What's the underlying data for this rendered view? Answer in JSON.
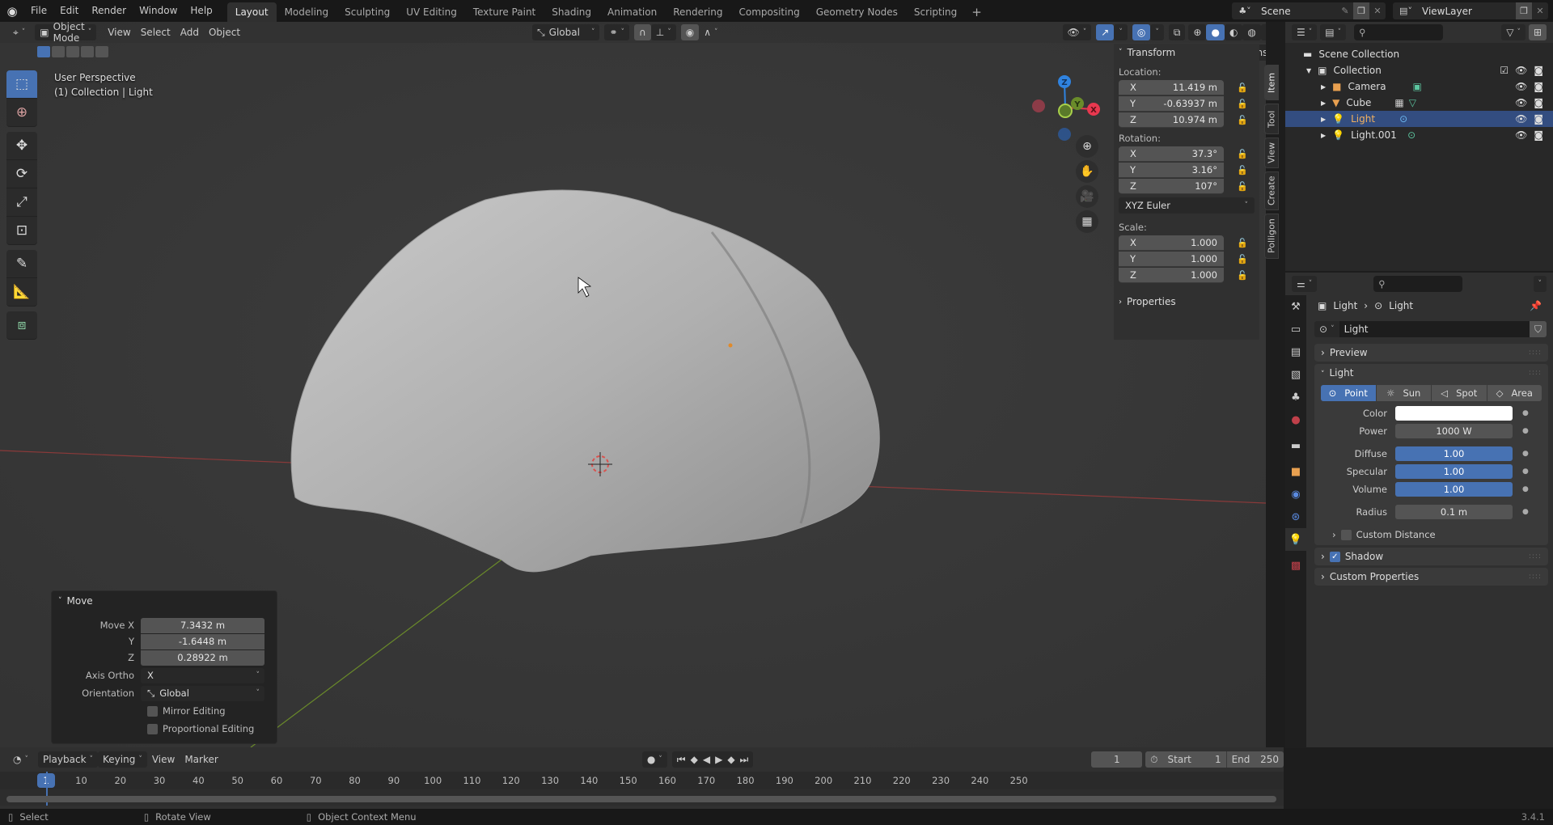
{
  "app": {
    "version": "3.4.1"
  },
  "topbar": {
    "menus": [
      "File",
      "Edit",
      "Render",
      "Window",
      "Help"
    ],
    "workspaces": [
      "Layout",
      "Modeling",
      "Sculpting",
      "UV Editing",
      "Texture Paint",
      "Shading",
      "Animation",
      "Rendering",
      "Compositing",
      "Geometry Nodes",
      "Scripting"
    ],
    "active_workspace": "Layout",
    "add_workspace": "+",
    "scene": "Scene",
    "view_layer": "ViewLayer"
  },
  "viewport": {
    "mode": "Object Mode",
    "menus": [
      "View",
      "Select",
      "Add",
      "Object"
    ],
    "orientation": "Global",
    "options_label": "Options",
    "info_line1": "User Perspective",
    "info_line2": "(1) Collection | Light",
    "gizmo_axes": {
      "x": "X",
      "y": "Y",
      "z": "Z"
    },
    "axis_colors": {
      "x": "#e8384f",
      "y": "#8cc63e",
      "z": "#2f83e0"
    }
  },
  "npanel": {
    "tabs": [
      "Item",
      "Tool",
      "View",
      "Create",
      "Polligon"
    ],
    "active_tab": "Item",
    "transform_title": "Transform",
    "location_label": "Location:",
    "location": [
      {
        "axis": "X",
        "value": "11.419 m"
      },
      {
        "axis": "Y",
        "value": "-0.63937 m"
      },
      {
        "axis": "Z",
        "value": "10.974 m"
      }
    ],
    "rotation_label": "Rotation:",
    "rotation": [
      {
        "axis": "X",
        "value": "37.3°"
      },
      {
        "axis": "Y",
        "value": "3.16°"
      },
      {
        "axis": "Z",
        "value": "107°"
      }
    ],
    "rotation_mode": "XYZ Euler",
    "scale_label": "Scale:",
    "scale": [
      {
        "axis": "X",
        "value": "1.000"
      },
      {
        "axis": "Y",
        "value": "1.000"
      },
      {
        "axis": "Z",
        "value": "1.000"
      }
    ],
    "properties_title": "Properties"
  },
  "move_panel": {
    "title": "Move",
    "move_x_label": "Move X",
    "move_x": "7.3432 m",
    "y_label": "Y",
    "move_y": "-1.6448 m",
    "z_label": "Z",
    "move_z": "0.28922 m",
    "axis_ortho_label": "Axis Ortho",
    "axis_ortho": "X",
    "orientation_label": "Orientation",
    "orientation": "Global",
    "mirror_editing": "Mirror Editing",
    "proportional_editing": "Proportional Editing"
  },
  "timeline": {
    "menus": [
      "Playback",
      "Keying",
      "View",
      "Marker"
    ],
    "current_frame": "1",
    "start_label": "Start",
    "start": "1",
    "end_label": "End",
    "end": "250",
    "ticks": [
      "10",
      "20",
      "30",
      "40",
      "50",
      "60",
      "70",
      "80",
      "90",
      "100",
      "110",
      "120",
      "130",
      "140",
      "150",
      "160",
      "170",
      "180",
      "190",
      "200",
      "210",
      "220",
      "230",
      "240",
      "250"
    ]
  },
  "statusbar": {
    "select": "Select",
    "rotate_view": "Rotate View",
    "context_menu": "Object Context Menu"
  },
  "outliner": {
    "scene_collection": "Scene Collection",
    "collection": "Collection",
    "items": [
      {
        "name": "Camera",
        "selected": false
      },
      {
        "name": "Cube",
        "selected": false
      },
      {
        "name": "Light",
        "selected": true
      },
      {
        "name": "Light.001",
        "selected": false
      }
    ]
  },
  "properties": {
    "breadcrumb_object": "Light",
    "breadcrumb_data": "Light",
    "datablock_name": "Light",
    "preview_title": "Preview",
    "light_title": "Light",
    "light_types": [
      "Point",
      "Sun",
      "Spot",
      "Area"
    ],
    "active_light_type": "Point",
    "color_label": "Color",
    "color_value": "#ffffff",
    "power_label": "Power",
    "power": "1000 W",
    "diffuse_label": "Diffuse",
    "diffuse": "1.00",
    "specular_label": "Specular",
    "specular": "1.00",
    "volume_label": "Volume",
    "volume": "1.00",
    "radius_label": "Radius",
    "radius": "0.1 m",
    "custom_distance": "Custom Distance",
    "shadow": "Shadow",
    "custom_properties": "Custom Properties"
  }
}
